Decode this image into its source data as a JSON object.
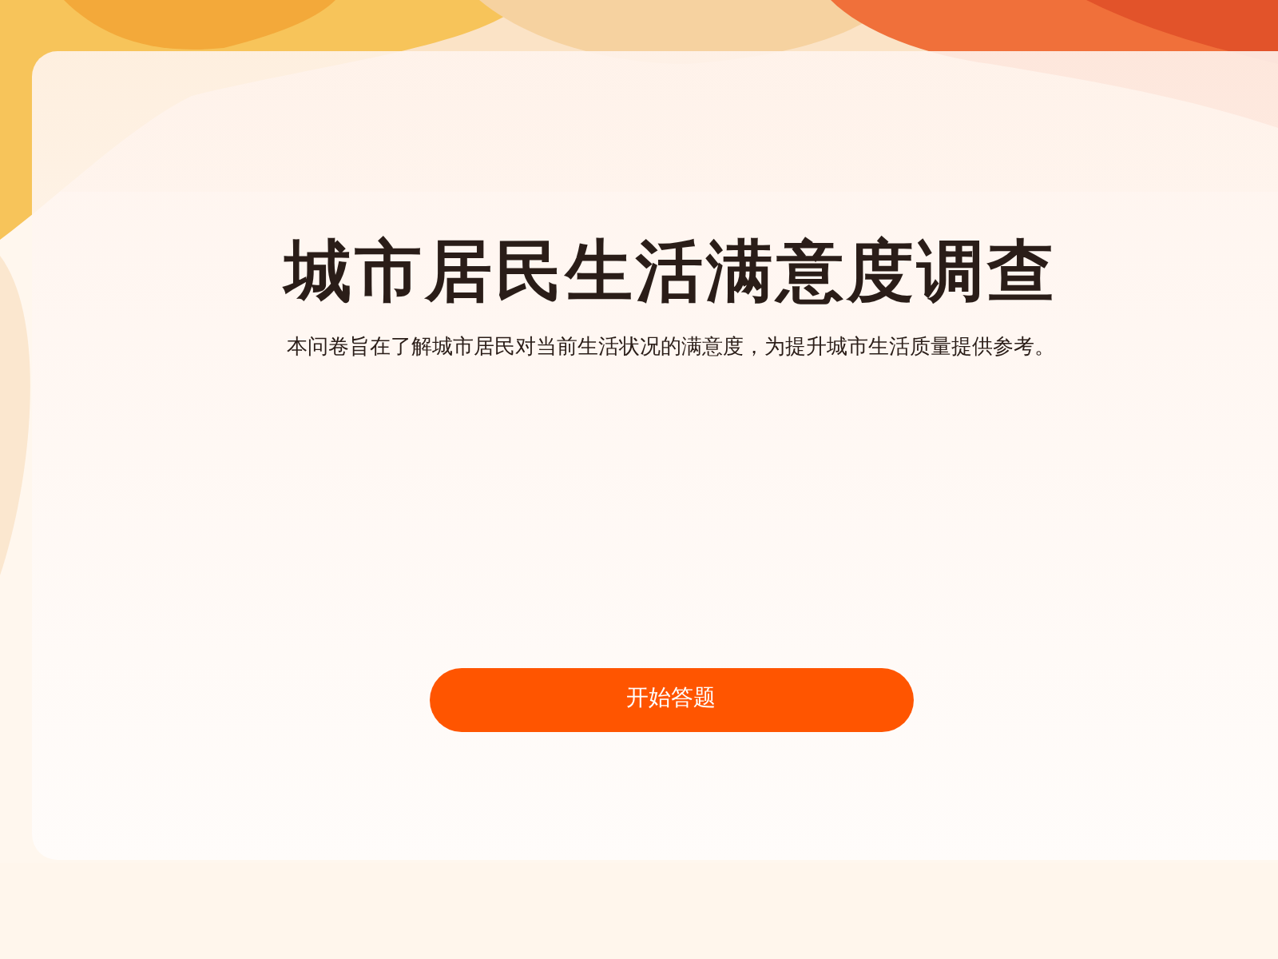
{
  "survey": {
    "title": "城市居民生活满意度调查",
    "description": "本问卷旨在了解城市居民对当前生活状况的满意度，为提升城市生活质量提供参考。",
    "start_button": "开始答题"
  }
}
